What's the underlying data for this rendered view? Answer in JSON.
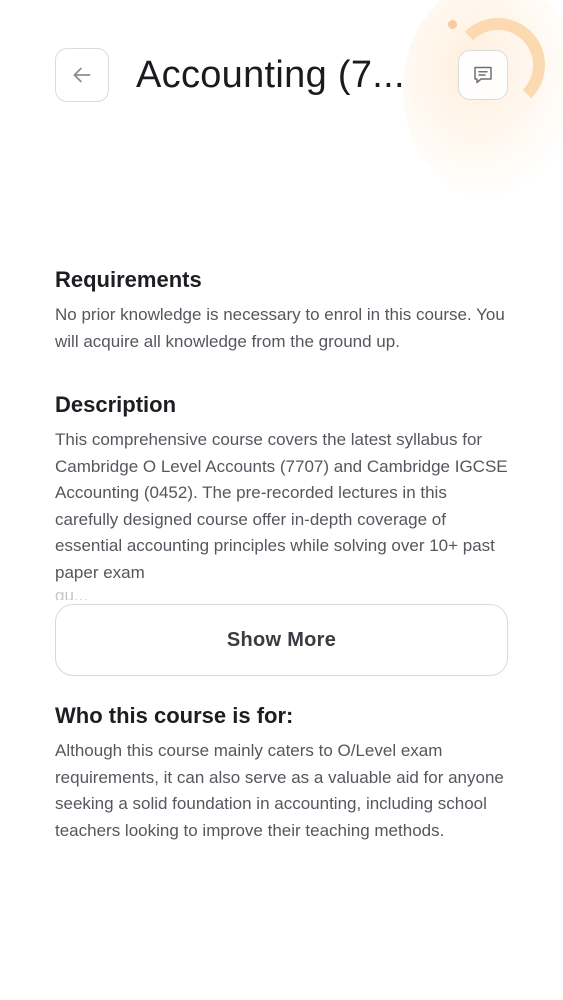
{
  "header": {
    "title": "Accounting (7...",
    "back_icon": "arrow-left-icon",
    "chat_icon": "chat-message-icon"
  },
  "requirements": {
    "title": "Requirements",
    "text": "No prior knowledge is necessary to enrol in this course. You will acquire all knowledge from the ground up."
  },
  "description": {
    "title": "Description",
    "text": "This comprehensive course covers the latest syllabus for Cambridge O Level Accounts (7707) and Cambridge IGCSE Accounting (0452). The pre-recorded lectures in this carefully designed course offer in-depth coverage of essential accounting principles while solving over 10+ past paper exam",
    "truncated_line": "qu...",
    "show_more_label": "Show More"
  },
  "audience": {
    "title": "Who this course is for:",
    "text": "Although this course mainly caters to O/Level exam requirements, it can also serve as a valuable aid for anyone seeking a solid foundation in accounting, including school teachers looking to improve their teaching methods."
  },
  "colors": {
    "heading": "#1d1d22",
    "body_text": "#55575e",
    "border": "#d9dce1",
    "accent_decor": "#f8c9a3"
  }
}
